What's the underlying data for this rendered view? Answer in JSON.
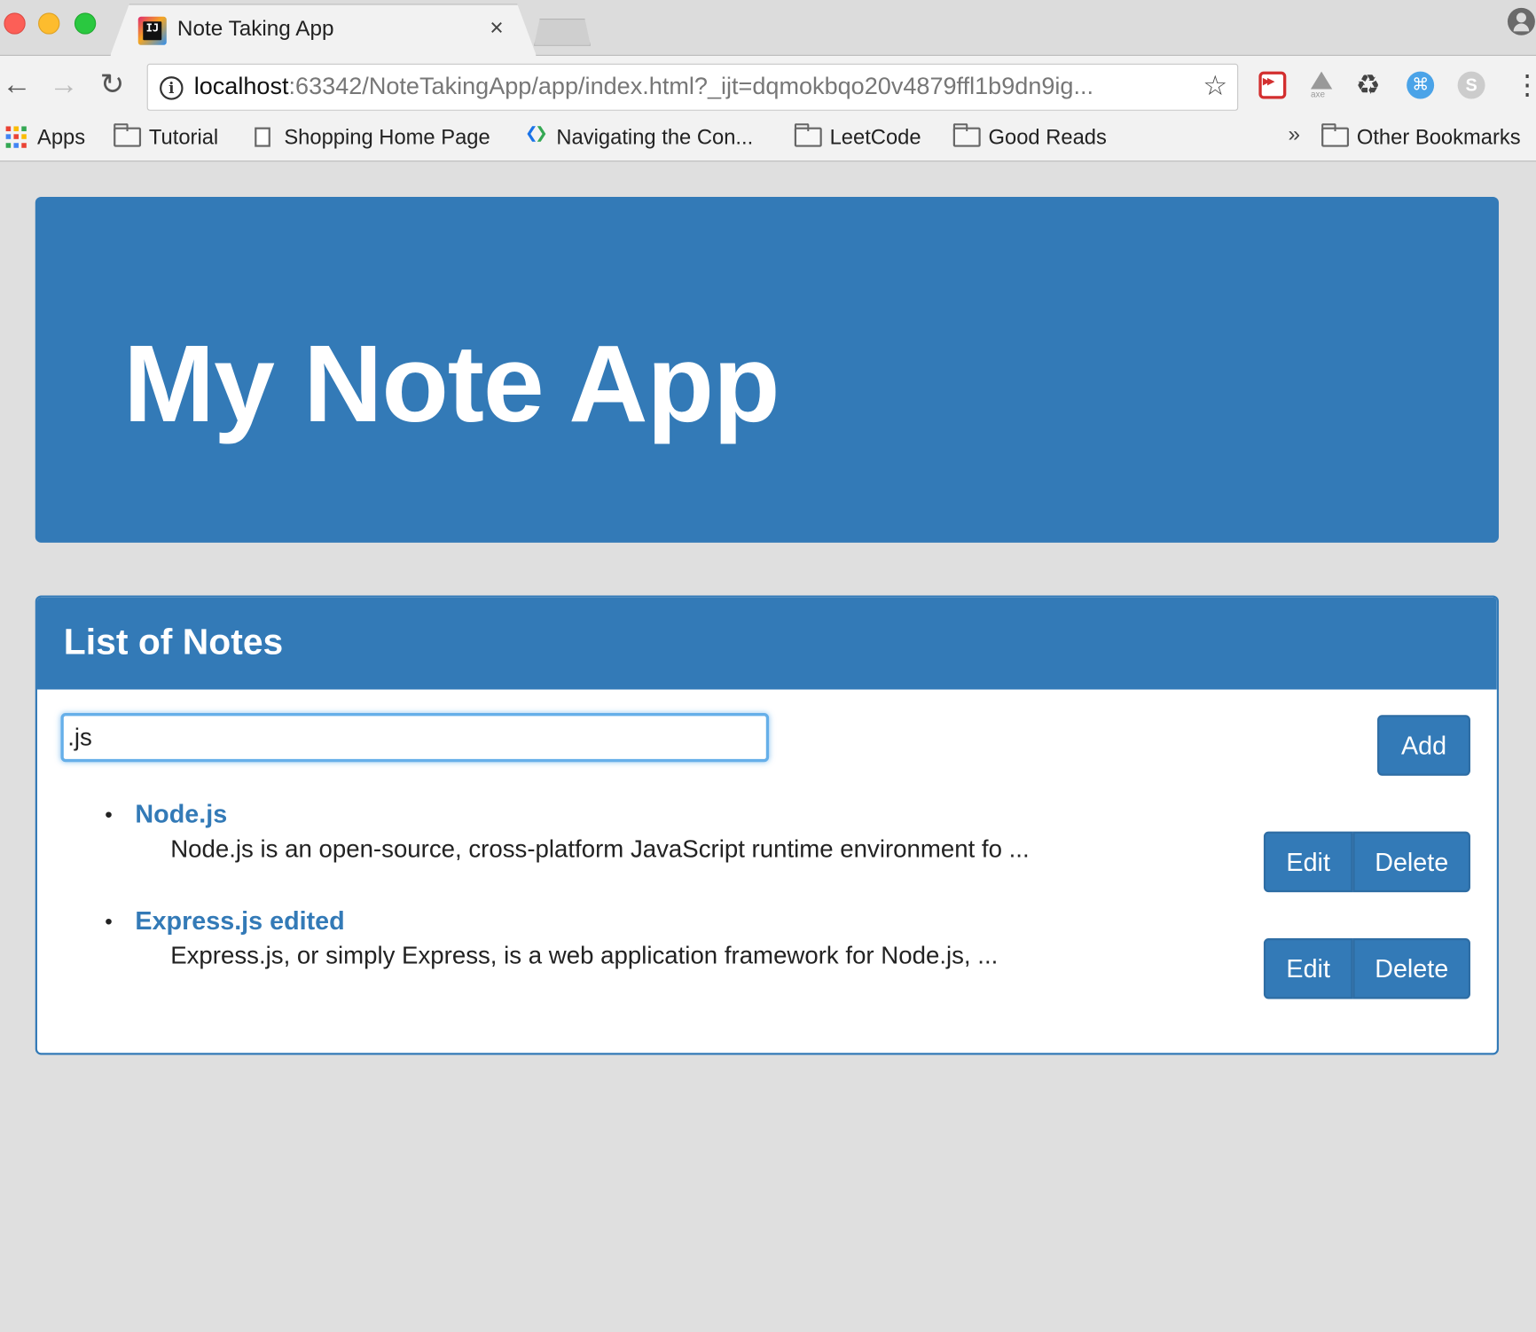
{
  "browser": {
    "tab_title": "Note Taking App",
    "tab_close": "×",
    "url_host": "localhost",
    "url_rest": ":63342/NoteTakingApp/app/index.html?_ijt=dqmokbqo20v4879ffl1b9dn9ig...",
    "bookmarks": [
      {
        "label": "Apps",
        "icon": "apps-grid-icon"
      },
      {
        "label": "Tutorial",
        "icon": "folder-icon"
      },
      {
        "label": "Shopping Home Page",
        "icon": "page-icon"
      },
      {
        "label": "Navigating the Con...",
        "icon": "google-dev-icon"
      },
      {
        "label": "LeetCode",
        "icon": "folder-icon"
      },
      {
        "label": "Good Reads",
        "icon": "folder-icon"
      }
    ],
    "bookmarks_overflow": "»",
    "other_bookmarks": "Other Bookmarks"
  },
  "jumbotron": {
    "title": "My Note App"
  },
  "panel": {
    "title": "List of Notes",
    "search_value": ".js",
    "add_label": "Add"
  },
  "notes": [
    {
      "title": "Node.js",
      "description": "Node.js is an open-source, cross-platform JavaScript runtime environment fo ...",
      "edit_label": "Edit",
      "delete_label": "Delete"
    },
    {
      "title": "Express.js edited",
      "description": "Express.js, or simply Express, is a web application framework for Node.js, ...",
      "edit_label": "Edit",
      "delete_label": "Delete"
    }
  ],
  "colors": {
    "primary": "#337ab7",
    "primary_border": "#2e6da4",
    "focus_ring": "#66afe9",
    "page_bg": "#dfdfdf"
  }
}
